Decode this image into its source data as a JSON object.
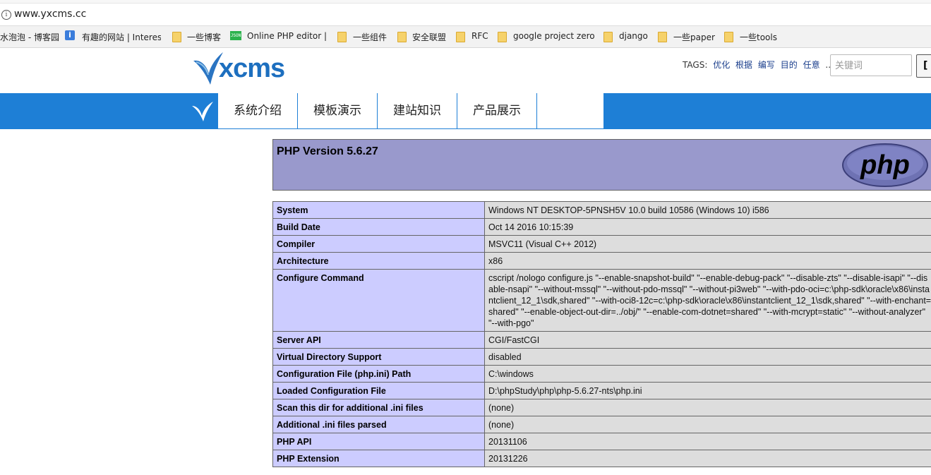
{
  "browser": {
    "url": "www.yxcms.cc",
    "bookmarks": [
      {
        "label": "水泡泡 - 博客园",
        "icon": "blog-icon"
      },
      {
        "label": "有趣的网站 | Interest",
        "icon": "info-icon"
      },
      {
        "label": "一些博客",
        "icon": "folder-icon"
      },
      {
        "label": "Online PHP editor |",
        "icon": "json-icon"
      },
      {
        "label": "一些组件",
        "icon": "folder-icon"
      },
      {
        "label": "安全联盟",
        "icon": "folder-icon"
      },
      {
        "label": "RFC",
        "icon": "folder-icon"
      },
      {
        "label": "google project zero",
        "icon": "folder-icon"
      },
      {
        "label": "django",
        "icon": "folder-icon"
      },
      {
        "label": "一些paper",
        "icon": "folder-icon"
      },
      {
        "label": "一些tools",
        "icon": "folder-icon"
      }
    ],
    "json_icon_text": "JSON"
  },
  "site": {
    "logo_text": "xcms",
    "tags_label": "TAGS:",
    "tags": [
      "优化",
      "根据",
      "编写",
      "目的",
      "任意",
      "..."
    ],
    "search_placeholder": "关键词",
    "search_button": "[",
    "nav": [
      "系统介绍",
      "模板演示",
      "建站知识",
      "产品展示"
    ],
    "colors": {
      "brand_blue": "#1e7fd6",
      "php_header": "#9999cc",
      "php_key": "#ccccff",
      "php_value": "#dddddd"
    }
  },
  "phpinfo": {
    "version_title": "PHP Version 5.6.27",
    "logo_text": "php",
    "rows": [
      {
        "key": "System",
        "value": "Windows NT DESKTOP-5PNSH5V 10.0 build 10586 (Windows 10) i586"
      },
      {
        "key": "Build Date",
        "value": "Oct 14 2016 10:15:39"
      },
      {
        "key": "Compiler",
        "value": "MSVC11 (Visual C++ 2012)"
      },
      {
        "key": "Architecture",
        "value": "x86"
      },
      {
        "key": "Configure Command",
        "value": "cscript /nologo configure.js \"--enable-snapshot-build\" \"--enable-debug-pack\" \"--disable-zts\" \"--disable-isapi\" \"--disable-nsapi\" \"--without-mssql\" \"--without-pdo-mssql\" \"--without-pi3web\" \"--with-pdo-oci=c:\\php-sdk\\oracle\\x86\\instantclient_12_1\\sdk,shared\" \"--with-oci8-12c=c:\\php-sdk\\oracle\\x86\\instantclient_12_1\\sdk,shared\" \"--with-enchant=shared\" \"--enable-object-out-dir=../obj/\" \"--enable-com-dotnet=shared\" \"--with-mcrypt=static\" \"--without-analyzer\" \"--with-pgo\""
      },
      {
        "key": "Server API",
        "value": "CGI/FastCGI"
      },
      {
        "key": "Virtual Directory Support",
        "value": "disabled"
      },
      {
        "key": "Configuration File (php.ini) Path",
        "value": "C:\\windows"
      },
      {
        "key": "Loaded Configuration File",
        "value": "D:\\phpStudy\\php\\php-5.6.27-nts\\php.ini"
      },
      {
        "key": "Scan this dir for additional .ini files",
        "value": "(none)"
      },
      {
        "key": "Additional .ini files parsed",
        "value": "(none)"
      },
      {
        "key": "PHP API",
        "value": "20131106"
      },
      {
        "key": "PHP Extension",
        "value": "20131226"
      }
    ]
  }
}
